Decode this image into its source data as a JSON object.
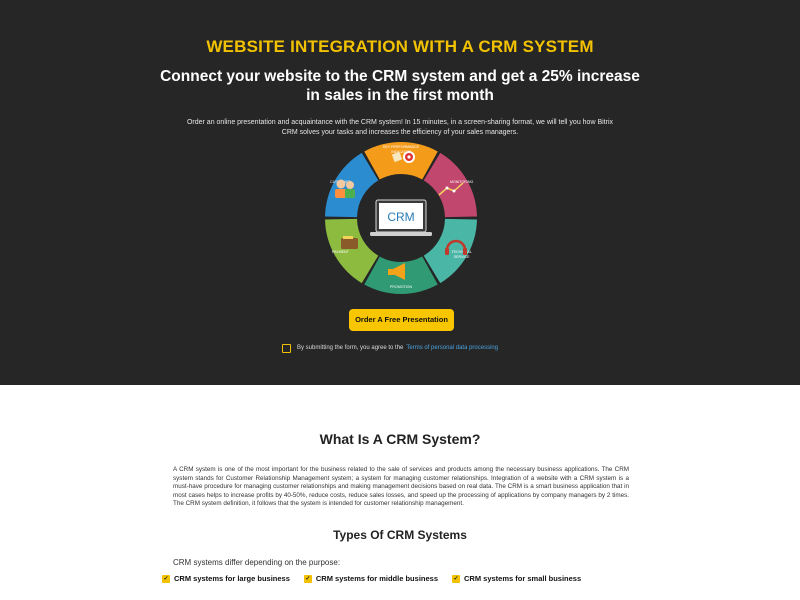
{
  "hero": {
    "title": "WEBSITE INTEGRATION WITH A CRM SYSTEM",
    "subtitle_line1": "Connect your website to the CRM system and get a 25% increase",
    "subtitle_line2": "in sales in the first month",
    "desc_line1": "Order an online presentation and acquaintance with the CRM system! In 15 minutes, in a screen-sharing format, we will tell you how Bitrix",
    "desc_line2": "CRM solves your tasks and increases the efficiency of your sales managers.",
    "wheel": {
      "center_label": "CRM",
      "segments": [
        {
          "label": "KEY PERFORMANCE INDICATOR",
          "color": "#f59b1a"
        },
        {
          "label": "MONITORING",
          "color": "#c2476e"
        },
        {
          "label": "TECHNICAL SERVICE",
          "color": "#49b6a6"
        },
        {
          "label": "PROMOTION",
          "color": "#2f9a73"
        },
        {
          "label": "PAYMENT",
          "color": "#8dbb40"
        },
        {
          "label": "CUSTOMER",
          "color": "#2b8dcf"
        }
      ]
    },
    "cta_label": "Order A Free Presentation",
    "consent_text": "By submitting the form, you agree to the",
    "consent_link": "Terms of personal data processing"
  },
  "main": {
    "title": "What Is A CRM System?",
    "paragraph": "A CRM system is one of the most important for the business related to the sale of services and products among the necessary business applications. The CRM system stands for Customer Relationship Management system; a system for managing customer relationships. Integration of a website with a CRM system is a must-have procedure for managing customer relationships and making management decisions based on real data. The CRM is a smart business application that in most cases helps to increase profits by 40-50%, reduce costs, reduce sales losses, and speed up the processing of applications by company managers by 2 times. The CRM system definition, it follows that the system is intended for customer relationship management.",
    "types_title": "Types Of CRM Systems",
    "types_intro": "CRM systems differ depending on the purpose:",
    "types": [
      "CRM systems for large business",
      "CRM systems for middle business",
      "CRM systems for small business"
    ]
  }
}
